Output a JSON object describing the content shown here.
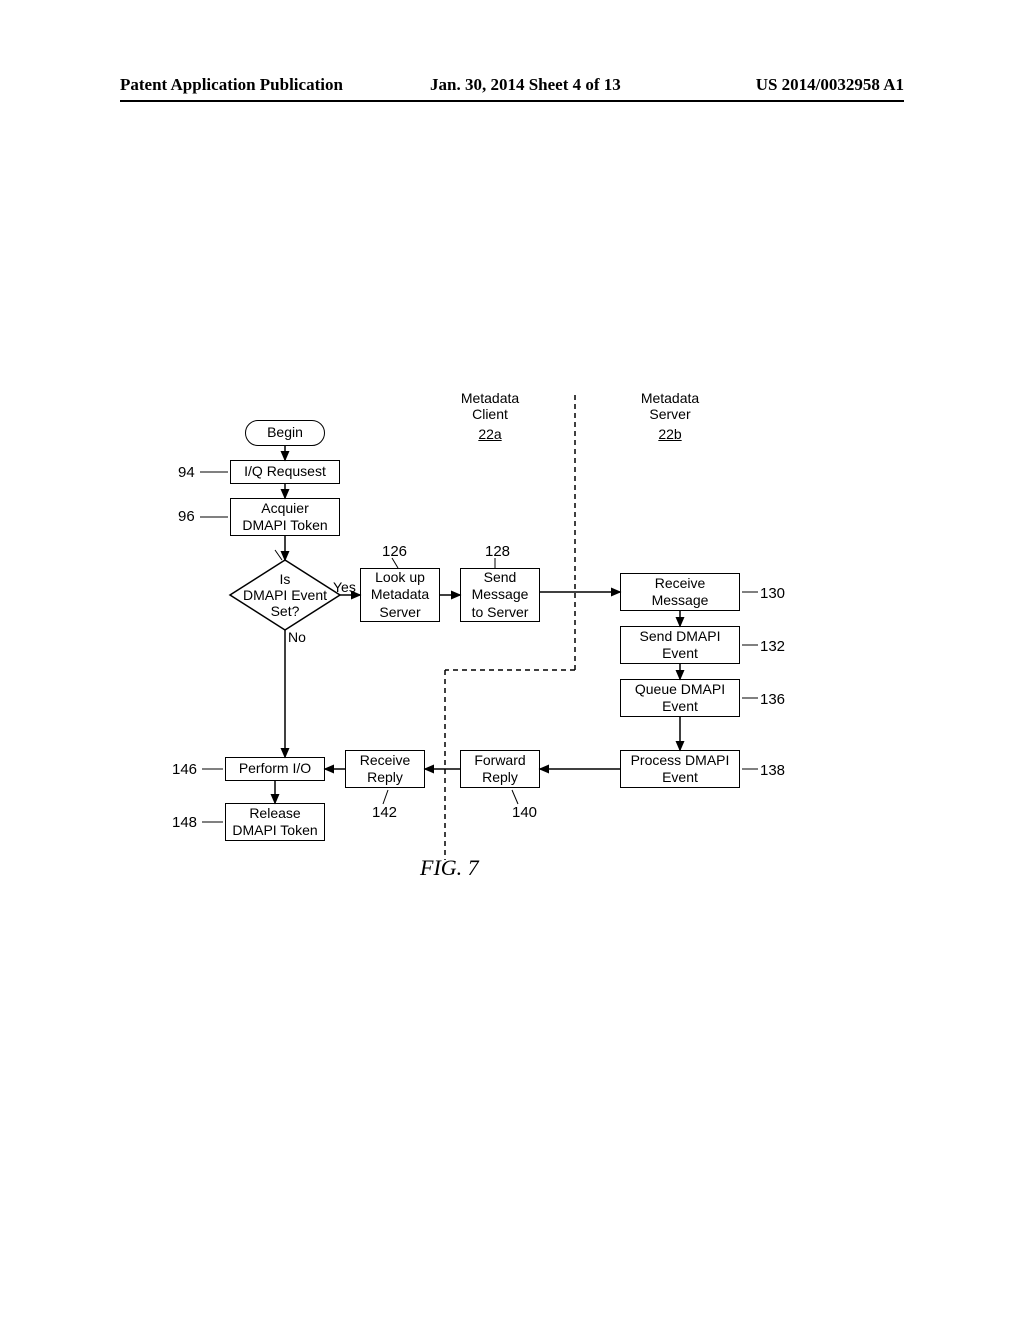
{
  "header": {
    "left": "Patent Application Publication",
    "center": "Jan. 30, 2014  Sheet 4 of 13",
    "right": "US 2014/0032958 A1"
  },
  "column_headers": {
    "client_title": "Metadata\nClient",
    "client_ref": "22a",
    "server_title": "Metadata\nServer",
    "server_ref": "22b"
  },
  "nodes": {
    "begin": "Begin",
    "io_request": "I/Q Requsest",
    "acquire": "Acquier\nDMAPI Token",
    "decision_l1": "Is",
    "decision_l2": "DMAPI Event",
    "decision_l3": "Set?",
    "lookup": "Look up\nMetadata\nServer",
    "send_msg": "Send\nMessage\nto Server",
    "recv_msg": "Receive\nMessage",
    "send_event": "Send DMAPI\nEvent",
    "queue_event": "Queue DMAPI\nEvent",
    "process_event": "Process DMAPI\nEvent",
    "forward_reply": "Forward\nReply",
    "recv_reply": "Receive\nReply",
    "perform_io": "Perform I/O",
    "release": "Release\nDMAPI Token"
  },
  "edge_labels": {
    "yes": "Yes",
    "no": "No"
  },
  "refs": {
    "r94": "94",
    "r96": "96",
    "r126": "126",
    "r128": "128",
    "r130": "130",
    "r132": "132",
    "r136": "136",
    "r138": "138",
    "r140": "140",
    "r142": "142",
    "r146": "146",
    "r148": "148"
  },
  "figure_caption": "FIG. 7"
}
